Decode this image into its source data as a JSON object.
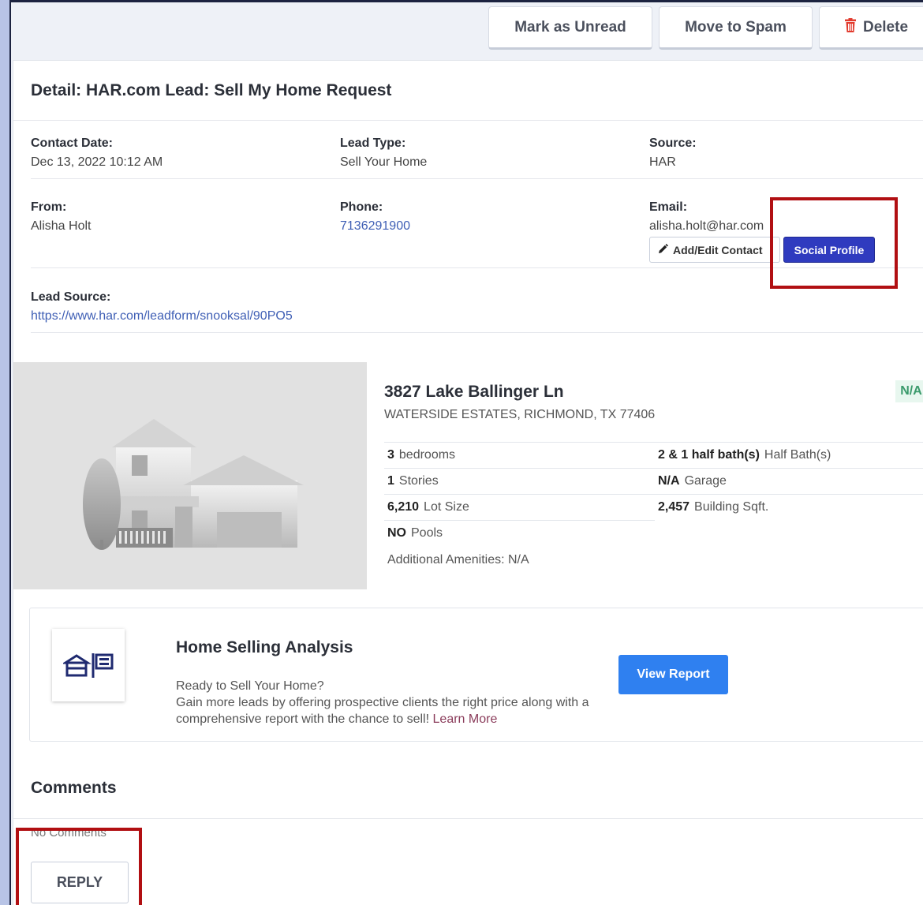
{
  "toolbar": {
    "mark_unread": "Mark as Unread",
    "move_spam": "Move to Spam",
    "delete": "Delete"
  },
  "detail": {
    "title": "Detail: HAR.com Lead: Sell My Home Request",
    "contact_date_label": "Contact Date:",
    "contact_date": "Dec 13, 2022 10:12 AM",
    "lead_type_label": "Lead Type:",
    "lead_type": "Sell Your Home",
    "source_label": "Source:",
    "source": "HAR",
    "from_label": "From:",
    "from": "Alisha Holt",
    "phone_label": "Phone:",
    "phone": "7136291900",
    "email_label": "Email:",
    "email": "alisha.holt@har.com",
    "add_edit_contact": "Add/Edit Contact",
    "social_profile": "Social Profile",
    "lead_source_label": "Lead Source:",
    "lead_source": "https://www.har.com/leadform/snooksal/90PO5"
  },
  "property": {
    "address": "3827 Lake Ballinger Ln",
    "city": "WATERSIDE ESTATES, RICHMOND, TX 77406",
    "badge": "N/A",
    "bedrooms_val": "3",
    "bedrooms_label": "bedrooms",
    "baths_val": "2 & 1 half bath(s)",
    "baths_label": "Half Bath(s)",
    "stories_val": "1",
    "stories_label": "Stories",
    "garage_val": "N/A",
    "garage_label": "Garage",
    "lot_val": "6,210",
    "lot_label": "Lot Size",
    "sqft_val": "2,457",
    "sqft_label": "Building Sqft.",
    "pools_val": "NO",
    "pools_label": "Pools",
    "amenities": "Additional Amenities: N/A"
  },
  "analysis": {
    "title": "Home Selling Analysis",
    "line1": "Ready to Sell Your Home?",
    "line2": "Gain more leads by offering prospective clients the right price along with a comprehensive report with the chance to sell!",
    "learn_more": "Learn More",
    "view_report": "View Report"
  },
  "comments": {
    "title": "Comments",
    "empty": "No Comments",
    "reply": "REPLY"
  }
}
